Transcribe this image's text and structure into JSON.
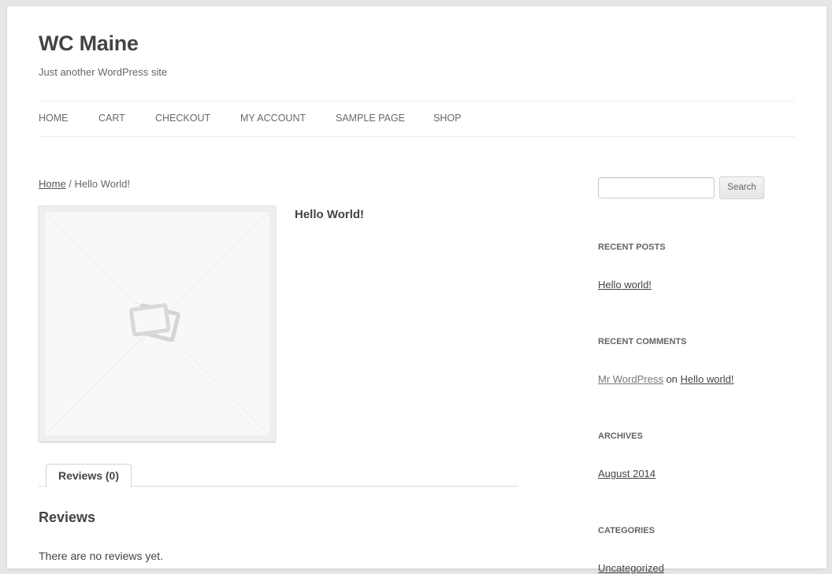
{
  "site": {
    "title": "WC Maine",
    "description": "Just another WordPress site"
  },
  "nav": {
    "items": [
      {
        "label": "HOME"
      },
      {
        "label": "CART"
      },
      {
        "label": "CHECKOUT"
      },
      {
        "label": "MY ACCOUNT"
      },
      {
        "label": "SAMPLE PAGE"
      },
      {
        "label": "SHOP"
      }
    ]
  },
  "breadcrumb": {
    "home": "Home",
    "separator": " / ",
    "current": "Hello World!"
  },
  "product": {
    "title": "Hello World!",
    "image_icon": "placeholder-image-icon"
  },
  "tabs": {
    "reviews_label": "Reviews (0)"
  },
  "reviews": {
    "heading": "Reviews",
    "empty_text": "There are no reviews yet."
  },
  "sidebar": {
    "search": {
      "placeholder": "",
      "button_label": "Search"
    },
    "recent_posts": {
      "title": "RECENT POSTS",
      "items": [
        "Hello world!"
      ]
    },
    "recent_comments": {
      "title": "RECENT COMMENTS",
      "author": "Mr WordPress",
      "on": "on",
      "post": "Hello world!"
    },
    "archives": {
      "title": "ARCHIVES",
      "items": [
        "August 2014"
      ]
    },
    "categories": {
      "title": "CATEGORIES",
      "items": [
        "Uncategorized"
      ]
    }
  }
}
